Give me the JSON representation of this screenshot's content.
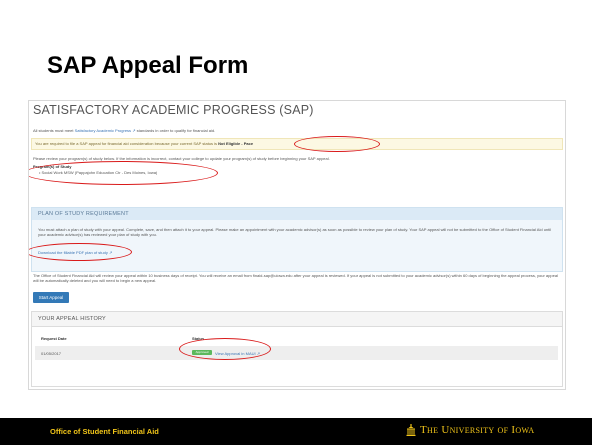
{
  "slide": {
    "title": "SAP Appeal Form"
  },
  "page": {
    "heading": "SATISFACTORY ACADEMIC PROGRESS (SAP)",
    "intro_text": "All students must meet",
    "intro_link": "Satisfactory Academic Progress",
    "intro_text_after": "standards in order to qualify for financial aid.",
    "warning_text": "You are required to file a SAP appeal for financial aid consideration because your current SAP status is",
    "warning_status": "Not Eligible - Pace",
    "verify_text": "Please review your program(s) of study below. If the information is incorrect, contact your college to update your program(s) of study before beginning your SAP appeal.",
    "programs_label": "Program(s) of Study",
    "programs": [
      "Social Work MSW (Pappajohn Education Ctr - Des Moines, Iowa)"
    ]
  },
  "plan_of_study": {
    "header": "PLAN OF STUDY REQUIREMENT",
    "text": "You must attach a plan of study with your appeal. Complete, save, and then attach it to your appeal. Please make an appointment with your academic advisor(s) as soon as possible to review your plan of study. Your SAP appeal will not be submitted to the Office of Student Financial Aid until your academic advisor(s) has reviewed your plan of study with you.",
    "download_link": "Download the fillable PDF plan of study"
  },
  "office_text": "The Office of Student Financial Aid will review your appeal within 10 business days of receipt. You will receive an email from finaid-sap@uiowa.edu after your appeal is reviewed. If your appeal is not submitted to your academic advisor(s) within 60 days of beginning the appeal process, your appeal will be automatically deleted and you will need to begin a new appeal.",
  "start_button": "Start Appeal",
  "history": {
    "header": "YOUR APPEAL HISTORY",
    "columns": [
      "Request Date",
      "Status"
    ],
    "rows": [
      {
        "date": "01/05/2017",
        "status": "Approved",
        "link": "View Approval in MAUI"
      }
    ]
  },
  "footer": {
    "office": "Office of Student Financial Aid",
    "university": "The University of Iowa"
  },
  "colors": {
    "accent": "#3379b7",
    "highlight": "#d91a1a",
    "gold": "#f0c419"
  }
}
